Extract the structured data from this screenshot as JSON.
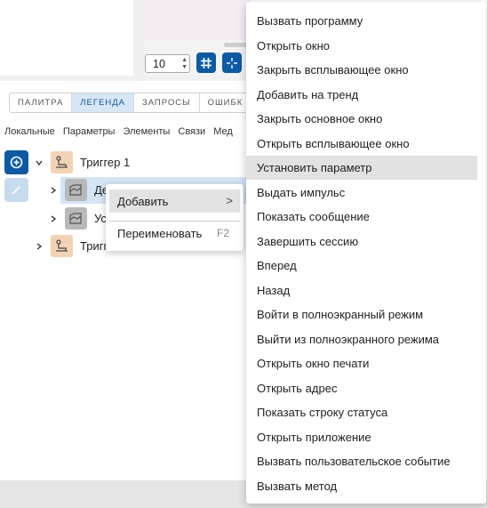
{
  "toolbar": {
    "zoom_value": "10",
    "grid_icon": "grid-icon",
    "move_icon": "move-icon"
  },
  "tabs": [
    {
      "label": "ПАЛИТРА"
    },
    {
      "label": "ЛЕГЕНДА",
      "active": true
    },
    {
      "label": "ЗАПРОСЫ"
    },
    {
      "label": "ОШИБК"
    }
  ],
  "subtabs": [
    "Локальные",
    "Параметры",
    "Элементы",
    "Связи",
    "Мед"
  ],
  "tree": {
    "trigger1_label": "Триггер 1",
    "child1_label": "Де",
    "child2_label": "Ус",
    "trigger2_label": "Тригг"
  },
  "context_menu": {
    "add_label": "Добавить",
    "add_arrow": ">",
    "rename_label": "Переименовать",
    "rename_shortcut": "F2"
  },
  "submenu": {
    "items": [
      "Вызвать программу",
      "Открыть окно",
      "Закрыть всплывающее окно",
      "Добавить на тренд",
      "Закрыть основное окно",
      "Открыть всплывающее окно",
      "Установить параметр",
      "Выдать импульс",
      "Показать сообщение",
      "Завершить сессию",
      "Вперед",
      "Назад",
      "Войти в полноэкранный режим",
      "Выйти из полноэкранного режима",
      "Открыть окно печати",
      "Открыть адрес",
      "Показать строку статуса",
      "Открыть приложение",
      "Вызвать пользовательское событие",
      "Вызвать метод"
    ],
    "highlighted_index": 6
  },
  "colors": {
    "accent": "#0b5aa3",
    "selection": "#d4e5f5",
    "trigger_icon_bg": "#f2d3b5"
  }
}
